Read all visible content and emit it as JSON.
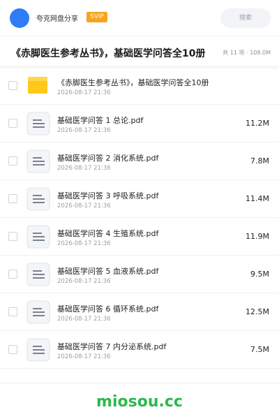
{
  "topbar": {
    "owner_name": "夸克网盘分享",
    "badge": "SVIP",
    "search_placeholder": "搜索"
  },
  "header": {
    "title": "《赤脚医生参考丛书》，基础医学问答全10册",
    "meta": "共 11 项 · 108.0M"
  },
  "files": [
    {
      "name": "《赤脚医生参考丛书》，基础医学问答全10册",
      "date": "2026-08-17 21:36",
      "size": "",
      "type": "folder-icon"
    },
    {
      "name": "基础医学问答 1 总论.pdf",
      "date": "2026-08-17 21:36",
      "size": "11.2M",
      "type": "pdf-file-icon"
    },
    {
      "name": "基础医学问答 2 消化系统.pdf",
      "date": "2026-08-17 21:36",
      "size": "7.8M",
      "type": "pdf-file-icon"
    },
    {
      "name": "基础医学问答 3 呼吸系统.pdf",
      "date": "2026-08-17 21:36",
      "size": "11.4M",
      "type": "pdf-file-icon"
    },
    {
      "name": "基础医学问答 4 生殖系统.pdf",
      "date": "2026-08-17 21:36",
      "size": "11.9M",
      "type": "pdf-file-icon"
    },
    {
      "name": "基础医学问答 5 血液系统.pdf",
      "date": "2026-08-17 21:36",
      "size": "9.5M",
      "type": "pdf-file-icon"
    },
    {
      "name": "基础医学问答 6 循环系统.pdf",
      "date": "2026-08-17 21:36",
      "size": "12.5M",
      "type": "pdf-file-icon"
    },
    {
      "name": "基础医学问答 7 内分泌系统.pdf",
      "date": "2026-08-17 21:36",
      "size": "7.5M",
      "type": "pdf-file-icon"
    }
  ],
  "footer": {
    "brand": "miosou.cc"
  },
  "colors": {
    "accent": "#2f7cf6",
    "svip": "#f7a31c",
    "folder": "#ffc81a",
    "brand": "#2db84d"
  }
}
